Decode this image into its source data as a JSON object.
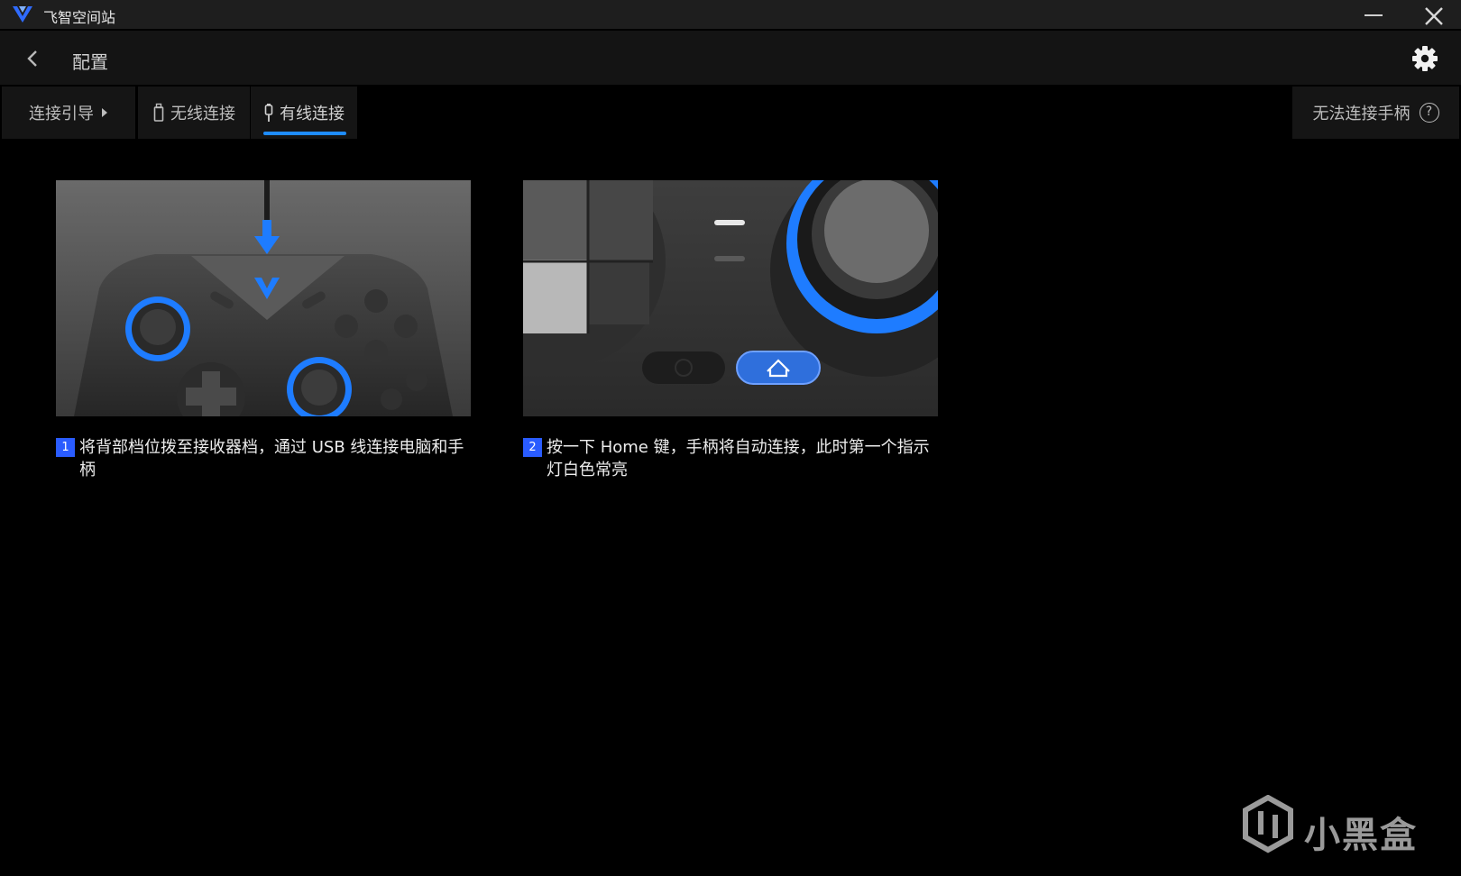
{
  "window": {
    "title": "飞智空间站",
    "accent_color": "#1e8cff"
  },
  "header": {
    "title": "配置",
    "back_icon": "chevron-left-icon",
    "settings_icon": "gear-icon"
  },
  "tabs": {
    "guide_label": "连接引导",
    "wireless_label": "无线连接",
    "wired_label": "有线连接",
    "active": "有线连接",
    "help_label": "无法连接手柄",
    "help_icon_glyph": "?"
  },
  "steps": [
    {
      "number": "1",
      "text": "将背部档位拨至接收器档，通过 USB 线连接电脑和手柄"
    },
    {
      "number": "2",
      "text": "按一下 Home 键，手柄将自动连接，此时第一个指示灯白色常亮"
    }
  ],
  "watermark": {
    "text": "小黑盒"
  }
}
